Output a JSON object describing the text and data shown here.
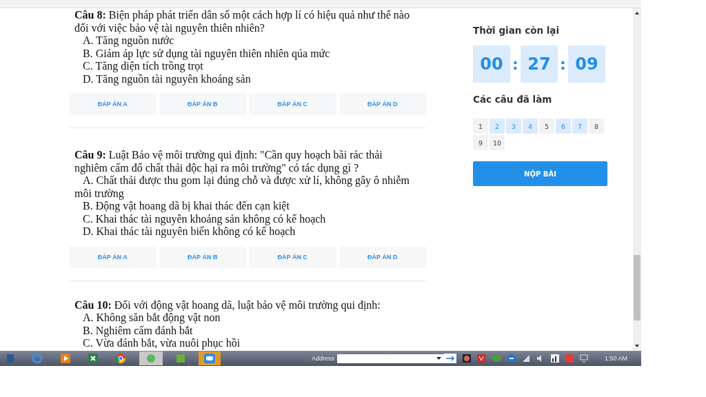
{
  "questions": [
    {
      "prompt": "**Câu 8:** Biện pháp phát triển dân số một cách hợp lí có hiệu quả như thế nào đối với việc bảo vệ tài nguyên thiên nhiên?",
      "options": [
        "A. Tăng nguồn nước",
        "B. Giảm áp lực sử dụng tài nguyên thiên nhiên qúa  mức",
        "C. Tăng diện tích trồng trọt",
        "D. Tăng nguồn tài nguyên khoáng sản"
      ],
      "answers": [
        "ĐÁP ÁN A",
        "ĐÁP ÁN B",
        "ĐÁP ÁN C",
        "ĐÁP ÁN D"
      ]
    },
    {
      "prompt": "**Câu 9:** Luật Bảo vệ môi trường qui định: \"Cần quy hoạch bãi rác thải nghiêm cấm đổ chất thải độc hại ra môi trường\" có tác dụng gì ?",
      "options": [
        "A. Chất thải được thu gom lại đúng chỗ và được xử lí, không gây ô nhiễm môi trường",
        "B. Động vật hoang dã bị khai thác đến cạn kiệt",
        "C. Khai thác tài nguyên khoáng sản không có kế hoạch",
        "D. Khai thác tài nguyên biển không có kế hoạch"
      ],
      "answers": [
        "ĐÁP ÁN A",
        "ĐÁP ÁN B",
        "ĐÁP ÁN C",
        "ĐÁP ÁN D"
      ]
    },
    {
      "prompt": "**Câu 10:** Đối với động vật hoang dã, luật bảo vệ môi trường qui định:",
      "options": [
        "A. Không săn bắt động vật non",
        "B. Nghiêm cấm đánh bắt",
        "C. Vừa đánh bắt, vừa nuôi phục hồi"
      ]
    }
  ],
  "sidebar": {
    "timer_title": "Thời gian còn lại",
    "timer": [
      "00",
      "27",
      "09"
    ],
    "separator": ":",
    "done_title": "Các câu đã làm",
    "done": [
      {
        "label": "1",
        "selected": false
      },
      {
        "label": "2",
        "selected": true
      },
      {
        "label": "3",
        "selected": true
      },
      {
        "label": "4",
        "selected": true
      },
      {
        "label": "5",
        "selected": false
      },
      {
        "label": "6",
        "selected": true
      },
      {
        "label": "7",
        "selected": true
      },
      {
        "label": "8",
        "selected": false
      },
      {
        "label": "9",
        "selected": false
      },
      {
        "label": "10",
        "selected": false
      }
    ],
    "submit": "NỘP BÀI"
  },
  "taskbar": {
    "address_label": "Address",
    "clock": "1:50 AM"
  }
}
